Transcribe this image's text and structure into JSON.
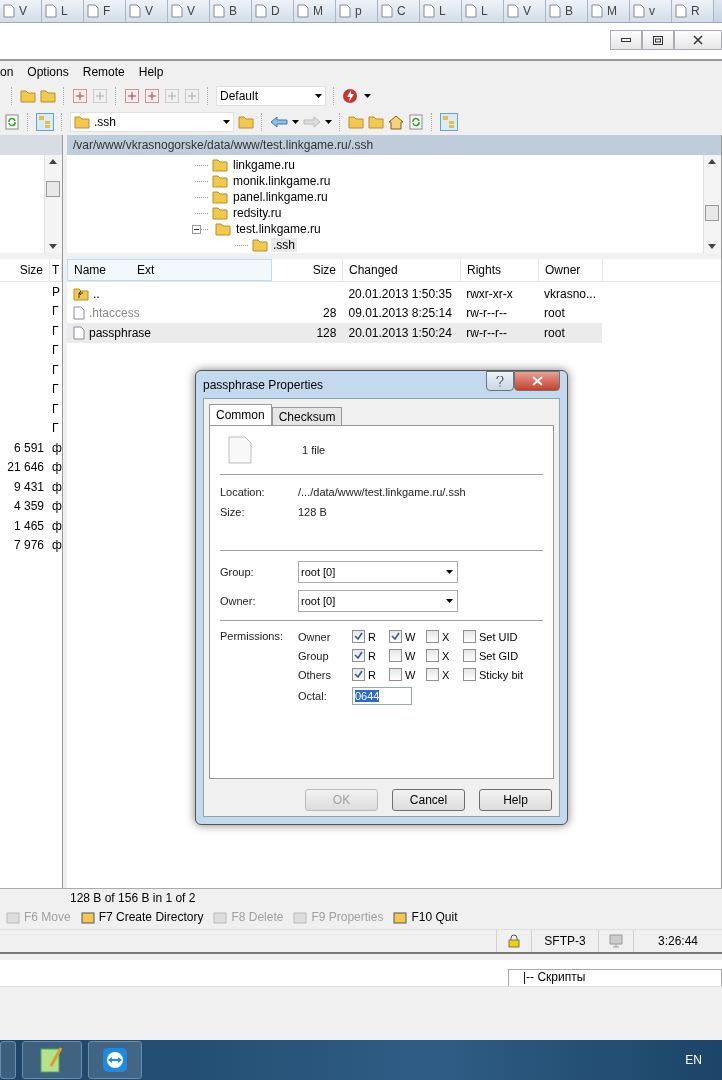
{
  "browser_tabs": [
    {
      "label": "V"
    },
    {
      "label": "L"
    },
    {
      "label": "F"
    },
    {
      "label": "V"
    },
    {
      "label": "V"
    },
    {
      "label": "B"
    },
    {
      "label": "D"
    },
    {
      "label": "M"
    },
    {
      "label": "p"
    },
    {
      "label": "C"
    },
    {
      "label": "L"
    },
    {
      "label": "L"
    },
    {
      "label": "V"
    },
    {
      "label": "B"
    },
    {
      "label": "M"
    },
    {
      "label": "v"
    },
    {
      "label": "R"
    }
  ],
  "menu": [
    "on",
    "Options",
    "Remote",
    "Help"
  ],
  "toolbar": {
    "profile": "Default"
  },
  "remote_dir_box": {
    "value": ".ssh"
  },
  "remote_path": "/var/www/vkrasnogorske/data/www/test.linkgame.ru/.ssh",
  "tree": [
    {
      "label": "linkgame.ru"
    },
    {
      "label": "monik.linkgame.ru"
    },
    {
      "label": "panel.linkgame.ru"
    },
    {
      "label": "redsity.ru"
    },
    {
      "label": "test.linkgame.ru",
      "expanded": true,
      "children": [
        {
          "label": ".ssh",
          "selected": true
        }
      ]
    }
  ],
  "local_panel": {
    "columns": [
      "Size",
      "T"
    ],
    "rows": [
      {
        "size": "",
        "type": "Р"
      },
      {
        "size": "",
        "type": "Г"
      },
      {
        "size": "",
        "type": "Г"
      },
      {
        "size": "",
        "type": "Г"
      },
      {
        "size": "",
        "type": "Г"
      },
      {
        "size": "",
        "type": "Г"
      },
      {
        "size": "",
        "type": "Г"
      },
      {
        "size": "",
        "type": "Г"
      },
      {
        "size": "6 591",
        "type": "ф"
      },
      {
        "size": "21 646",
        "type": "ф"
      },
      {
        "size": "9 431",
        "type": "ф"
      },
      {
        "size": "4 359",
        "type": "ф"
      },
      {
        "size": "1 465",
        "type": "ф"
      },
      {
        "size": "7 976",
        "type": "ф"
      }
    ]
  },
  "remote_panel": {
    "columns": [
      "Name",
      "Ext",
      "Size",
      "Changed",
      "Rights",
      "Owner"
    ],
    "rows": [
      {
        "kind": "parent",
        "name": "..",
        "size": "",
        "changed": "20.01.2013 1:50:35",
        "rights": "rwxr-xr-x",
        "owner": "vkrasno...",
        "selected": false,
        "dimmed": false
      },
      {
        "kind": "file",
        "name": ".htaccess",
        "size": "28",
        "changed": "09.01.2013 8:25:14",
        "rights": "rw-r--r--",
        "owner": "root",
        "selected": false,
        "dimmed": true
      },
      {
        "kind": "file",
        "name": "passphrase",
        "size": "128",
        "changed": "20.01.2013 1:50:24",
        "rights": "rw-r--r--",
        "owner": "root",
        "selected": true,
        "dimmed": false
      }
    ]
  },
  "dialog": {
    "title": "passphrase Properties",
    "tabs": [
      {
        "label": "Common",
        "selected": true
      },
      {
        "label": "Checksum",
        "selected": false
      }
    ],
    "summary": "1 file",
    "info": [
      {
        "label": "Location:",
        "value": "/.../data/www/test.linkgame.ru/.ssh"
      },
      {
        "label": "Size:",
        "value": "128 B"
      }
    ],
    "selects": [
      {
        "label": "Group:",
        "value": "root [0]"
      },
      {
        "label": "Owner:",
        "value": "root [0]"
      }
    ],
    "permissions_label": "Permissions:",
    "permissions": [
      {
        "label": "Owner",
        "checks": [
          {
            "label": "R",
            "checked": true
          },
          {
            "label": "W",
            "checked": true
          },
          {
            "label": "X",
            "checked": false
          },
          {
            "label": "Set UID",
            "checked": false
          }
        ]
      },
      {
        "label": "Group",
        "checks": [
          {
            "label": "R",
            "checked": true
          },
          {
            "label": "W",
            "checked": false
          },
          {
            "label": "X",
            "checked": false
          },
          {
            "label": "Set GID",
            "checked": false
          }
        ]
      },
      {
        "label": "Others",
        "checks": [
          {
            "label": "R",
            "checked": true
          },
          {
            "label": "W",
            "checked": false
          },
          {
            "label": "X",
            "checked": false
          },
          {
            "label": "Sticky bit",
            "checked": false
          }
        ]
      }
    ],
    "octal": {
      "label": "Octal:",
      "value": "0644"
    },
    "buttons": [
      {
        "label": "OK",
        "disabled": true
      },
      {
        "label": "Cancel",
        "disabled": false
      },
      {
        "label": "Help",
        "disabled": false
      }
    ]
  },
  "selection_info": "128 B of 156 B in 1 of 2",
  "fkeys": [
    {
      "label": "F6 Move",
      "disabled": true
    },
    {
      "label": "F7 Create Directory",
      "disabled": false
    },
    {
      "label": "F8 Delete",
      "disabled": true
    },
    {
      "label": "F9 Properties",
      "disabled": true
    },
    {
      "label": "F10 Quit",
      "disabled": false
    }
  ],
  "status_bar": {
    "protocol": "SFTP-3",
    "time": "3:26:44"
  },
  "scripts_box": "|-- Скрипты",
  "taskbar": {
    "language": "EN"
  }
}
